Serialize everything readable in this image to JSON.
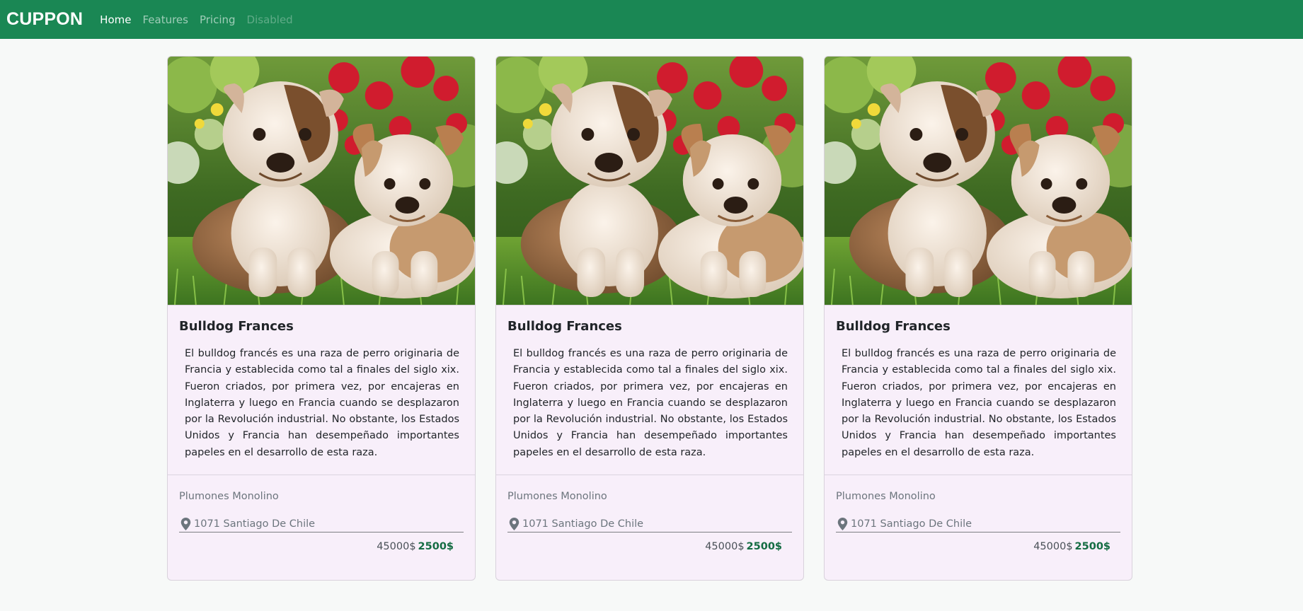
{
  "nav": {
    "brand": "CUPPON",
    "links": [
      {
        "label": "Home",
        "state": "active"
      },
      {
        "label": "Features",
        "state": "normal"
      },
      {
        "label": "Pricing",
        "state": "normal"
      },
      {
        "label": "Disabled",
        "state": "disabled"
      }
    ]
  },
  "colors": {
    "navbar": "#1a8754",
    "card_background": "#f8effa",
    "page_background": "#f7f9f8",
    "price_accent": "#146c43"
  },
  "cards": [
    {
      "image_icon": "bulldog-puppies-photo",
      "title": "Bulldog Frances",
      "description": "El bulldog francés es una raza de perro originaria de Francia y establecida como tal a finales del siglo xix. Fueron criados, por primera vez, por encajeras en Inglaterra y luego en Francia cuando se desplazaron por la Revolución industrial. No obstante, los Estados Unidos y Francia han desempeñado importantes papeles en el desarrollo de esta raza.",
      "footer_title": "Plumones Monolino",
      "address": "1071 Santiago De Chile",
      "old_price": "45000$",
      "new_price": "2500$"
    },
    {
      "image_icon": "bulldog-puppies-photo",
      "title": "Bulldog Frances",
      "description": "El bulldog francés es una raza de perro originaria de Francia y establecida como tal a finales del siglo xix. Fueron criados, por primera vez, por encajeras en Inglaterra y luego en Francia cuando se desplazaron por la Revolución industrial. No obstante, los Estados Unidos y Francia han desempeñado importantes papeles en el desarrollo de esta raza.",
      "footer_title": "Plumones Monolino",
      "address": "1071 Santiago De Chile",
      "old_price": "45000$",
      "new_price": "2500$"
    },
    {
      "image_icon": "bulldog-puppies-photo",
      "title": "Bulldog Frances",
      "description": "El bulldog francés es una raza de perro originaria de Francia y establecida como tal a finales del siglo xix. Fueron criados, por primera vez, por encajeras en Inglaterra y luego en Francia cuando se desplazaron por la Revolución industrial. No obstante, los Estados Unidos y Francia han desempeñado importantes papeles en el desarrollo de esta raza.",
      "footer_title": "Plumones Monolino",
      "address": "1071 Santiago De Chile",
      "old_price": "45000$",
      "new_price": "2500$"
    }
  ]
}
